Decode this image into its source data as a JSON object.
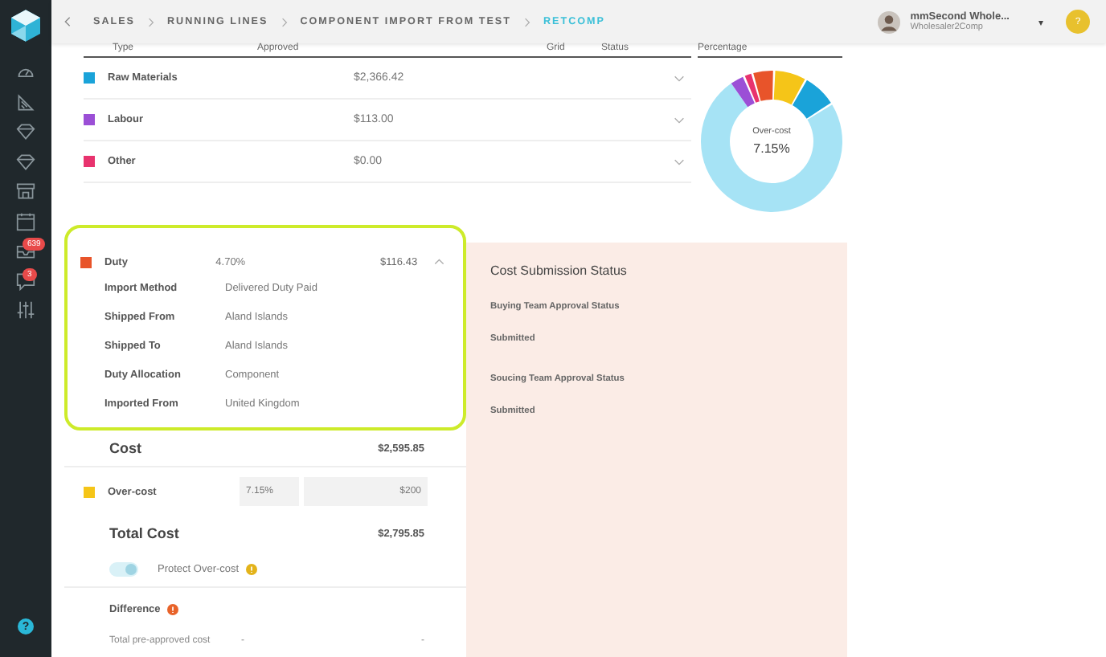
{
  "sidebar": {
    "items": [
      {
        "kind": "gauge"
      },
      {
        "kind": "layers"
      },
      {
        "kind": "gem"
      },
      {
        "kind": "gem"
      },
      {
        "kind": "store"
      },
      {
        "kind": "calendar"
      },
      {
        "kind": "inbox",
        "badge": "639"
      },
      {
        "kind": "chat",
        "badge": "3"
      },
      {
        "kind": "sliders"
      }
    ],
    "help": "?"
  },
  "breadcrumbs": [
    {
      "label": "SALES",
      "selected": false
    },
    {
      "label": "RUNNING LINES",
      "selected": false
    },
    {
      "label": "COMPONENT IMPORT FROM TEST",
      "selected": false
    },
    {
      "label": "RETCOMP",
      "selected": true
    }
  ],
  "user": {
    "name": "mmSecond Whole...",
    "company": "Wholesaler2Comp",
    "caret": "▾",
    "help": "?"
  },
  "table": {
    "columns": [
      "Type",
      "Approved",
      "Grid",
      "Status",
      "Percentage"
    ],
    "rows": [
      {
        "name": "Raw Materials",
        "approved": "$2,366.42",
        "color": "#1aa3d9",
        "expanded": false
      },
      {
        "name": "Labour",
        "approved": "$113.00",
        "color": "#9b4fd6",
        "expanded": false
      },
      {
        "name": "Other",
        "approved": "$0.00",
        "color": "#e8336e",
        "expanded": false
      }
    ]
  },
  "donut": {
    "label": "Over-cost",
    "value": "7.15%"
  },
  "duty": {
    "name": "Duty",
    "color": "#e8542a",
    "percent": "4.70%",
    "amount": "$116.43",
    "expanded": true,
    "details": [
      {
        "label": "Import Method",
        "value": "Delivered Duty Paid"
      },
      {
        "label": "Shipped From",
        "value": "Aland Islands"
      },
      {
        "label": "Shipped To",
        "value": "Aland Islands"
      },
      {
        "label": "Duty Allocation",
        "value": "Component"
      },
      {
        "label": "Imported From",
        "value": "United Kingdom"
      }
    ]
  },
  "cost": {
    "label": "Cost",
    "value": "$2,595.85"
  },
  "over_cost": {
    "label": "Over-cost",
    "color": "#f5c518",
    "percent": "7.15%",
    "amount": "$200"
  },
  "total": {
    "label": "Total Cost",
    "value": "$2,795.85"
  },
  "protect": {
    "label": "Protect Over-cost",
    "on": true
  },
  "difference": {
    "label": "Difference",
    "rows": [
      {
        "label": "Total pre-approved cost",
        "column_2": "-",
        "column_3": "-"
      }
    ]
  },
  "status_panel": {
    "title": "Cost Submission Status",
    "items": [
      {
        "label": "Buying Team Approval Status",
        "value": "Submitted"
      },
      {
        "label": "Soucing Team Approval Status",
        "value": "Submitted"
      }
    ]
  }
}
